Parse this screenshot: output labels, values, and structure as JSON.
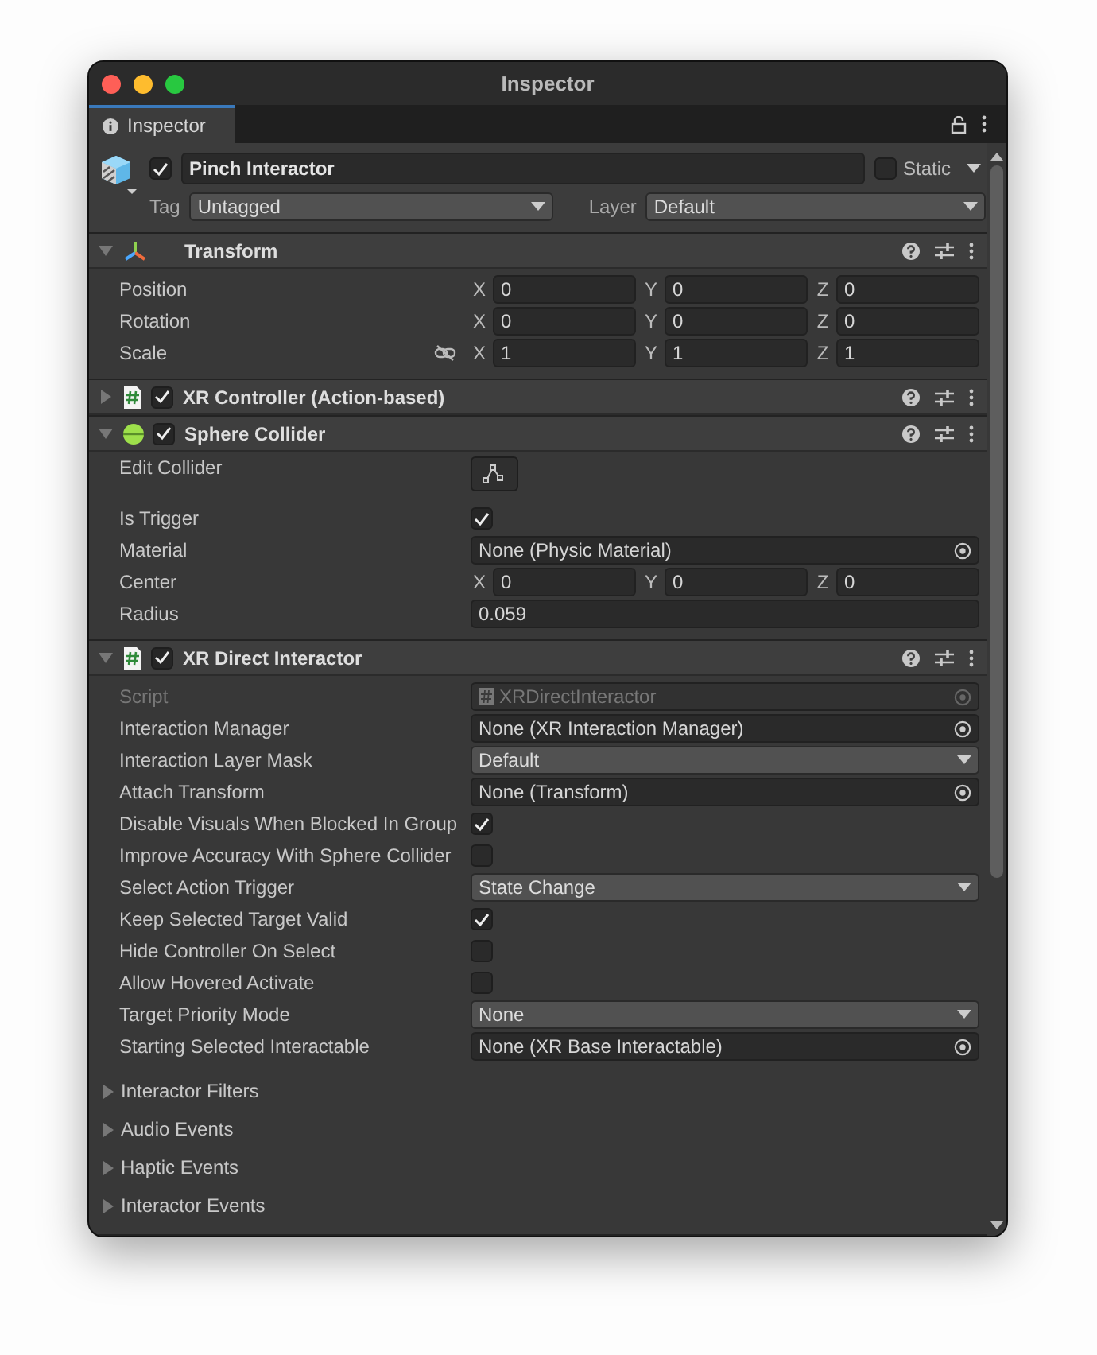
{
  "window": {
    "title": "Inspector"
  },
  "tab": {
    "label": "Inspector",
    "selected": true
  },
  "gameobject": {
    "active": true,
    "name": "Pinch Interactor",
    "static_label": "Static",
    "static": false,
    "tag_label": "Tag",
    "tag": "Untagged",
    "layer_label": "Layer",
    "layer": "Default"
  },
  "components": [
    {
      "kind": "transform",
      "title": "Transform",
      "expanded": true,
      "properties": [
        {
          "kind": "vector",
          "label": "Position",
          "axes": [
            {
              "axis": "X",
              "value": "0"
            },
            {
              "axis": "Y",
              "value": "0"
            },
            {
              "axis": "Z",
              "value": "0"
            }
          ]
        },
        {
          "kind": "vector",
          "label": "Rotation",
          "axes": [
            {
              "axis": "X",
              "value": "0"
            },
            {
              "axis": "Y",
              "value": "0"
            },
            {
              "axis": "Z",
              "value": "0"
            }
          ]
        },
        {
          "kind": "vector",
          "label": "Scale",
          "linked": false,
          "axes": [
            {
              "axis": "X",
              "value": "1"
            },
            {
              "axis": "Y",
              "value": "1"
            },
            {
              "axis": "Z",
              "value": "1"
            }
          ]
        }
      ]
    },
    {
      "kind": "script",
      "title": "XR Controller (Action-based)",
      "expanded": false,
      "enabled": true
    },
    {
      "kind": "sphere",
      "title": "Sphere Collider",
      "expanded": true,
      "enabled": true,
      "properties": [
        {
          "kind": "edit_button",
          "label": "Edit Collider"
        },
        {
          "kind": "checkbox",
          "label": "Is Trigger",
          "checked": true
        },
        {
          "kind": "object",
          "label": "Material",
          "value": "None (Physic Material)"
        },
        {
          "kind": "vector",
          "label": "Center",
          "axes": [
            {
              "axis": "X",
              "value": "0"
            },
            {
              "axis": "Y",
              "value": "0"
            },
            {
              "axis": "Z",
              "value": "0"
            }
          ]
        },
        {
          "kind": "text",
          "label": "Radius",
          "value": "0.059"
        }
      ]
    },
    {
      "kind": "script",
      "title": "XR Direct Interactor",
      "expanded": true,
      "enabled": true,
      "properties": [
        {
          "kind": "object",
          "label": "Script",
          "value": "XRDirectInteractor",
          "disabled": true
        },
        {
          "kind": "object",
          "label": "Interaction Manager",
          "value": "None (XR Interaction Manager)"
        },
        {
          "kind": "dropdown",
          "label": "Interaction Layer Mask",
          "value": "Default"
        },
        {
          "kind": "object",
          "label": "Attach Transform",
          "value": "None (Transform)"
        },
        {
          "kind": "checkbox",
          "label": "Disable Visuals When Blocked In Group",
          "checked": true
        },
        {
          "kind": "checkbox",
          "label": "Improve Accuracy With Sphere Collider",
          "checked": false
        },
        {
          "kind": "dropdown",
          "label": "Select Action Trigger",
          "value": "State Change"
        },
        {
          "kind": "checkbox",
          "label": "Keep Selected Target Valid",
          "checked": true
        },
        {
          "kind": "checkbox",
          "label": "Hide Controller On Select",
          "checked": false
        },
        {
          "kind": "checkbox",
          "label": "Allow Hovered Activate",
          "checked": false
        },
        {
          "kind": "dropdown",
          "label": "Target Priority Mode",
          "value": "None"
        },
        {
          "kind": "object",
          "label": "Starting Selected Interactable",
          "value": "None (XR Base Interactable)"
        },
        {
          "kind": "foldout",
          "label": "Interactor Filters",
          "expanded": false
        },
        {
          "kind": "foldout",
          "label": "Audio Events",
          "expanded": false
        },
        {
          "kind": "foldout",
          "label": "Haptic Events",
          "expanded": false
        },
        {
          "kind": "foldout",
          "label": "Interactor Events",
          "expanded": false
        }
      ]
    }
  ]
}
